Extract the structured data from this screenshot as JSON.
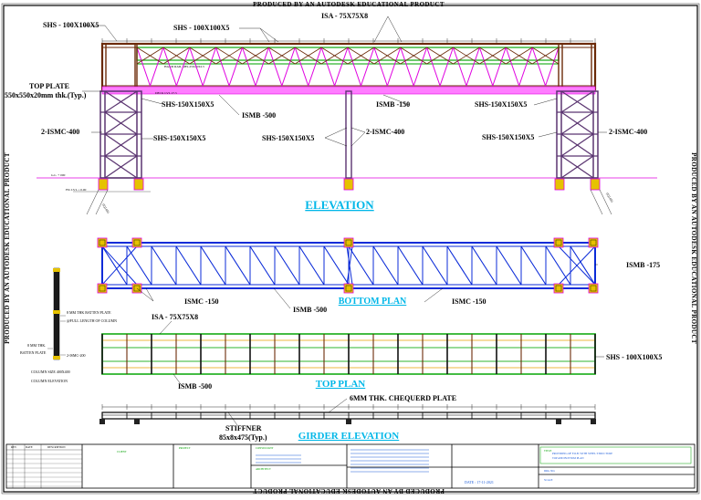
{
  "watermark": "PRODUCED BY AN AUTODESK EDUCATIONAL PRODUCT",
  "labels": {
    "shs100_left": "SHS - 100X100X5",
    "shs100_mid": "SHS - 100X100X5",
    "isa75_top": "ISA - 75X75X8",
    "top_plate_1": "TOP PLATE",
    "top_plate_2": "550x550x20mm thk.(Typ.)",
    "shs150_a": "SHS-150X150X5",
    "ismb500_a": "ISMB -500",
    "ismb150": "ISMB -150",
    "shs150_b": "SHS-150X150X5",
    "ismc400_left": "2-ISMC-400",
    "shs150_c": "SHS-150X150X5",
    "shs150_d": "SHS-150X150X5",
    "ismc400_mid": "2-ISMC-400",
    "shs150_e": "SHS-150X150X5",
    "ismc400_right": "2-ISMC-400",
    "elevation": "ELEVATION",
    "ismb175": "ISMB -175",
    "ismc150_left": "ISMC -150",
    "bottom_plan": "BOTTOM PLAN",
    "ismc150_right": "ISMC -150",
    "ismb500_b": "ISMB -500",
    "isa75_mid": "ISA - 75X75X8",
    "batten_1": "8 MM THK BATTEN PLATE",
    "batten_2": "@FULL LENGTH OF COLUMN",
    "batten_3": "8 MM THK.",
    "batten_4": "BATTEN PLATE",
    "ismc200": "2-ISMC-200",
    "col_size": "COLUMN SIZE 400X400",
    "col_elev": "COLUMN ELEVATION",
    "shs100_right": "SHS - 100X100X5",
    "top_plan": "TOP PLAN",
    "ismb500_c": "ISMB -500",
    "chequerd": "6MM THK. CHEQUERD PLATE",
    "stiffner_1": "STIFFNER",
    "stiffner_2": "85x8x475(Typ.)",
    "girder_elev": "GIRDER ELEVATION"
  },
  "colors": {
    "structure": "#6b2a08",
    "column": "#5a3470",
    "truss_green": "#2fb52f",
    "truss_magenta": "#e000e0",
    "plan_blue": "#0b2bd8",
    "heading": "#00b7e8",
    "base_plate": "#e6c200"
  }
}
